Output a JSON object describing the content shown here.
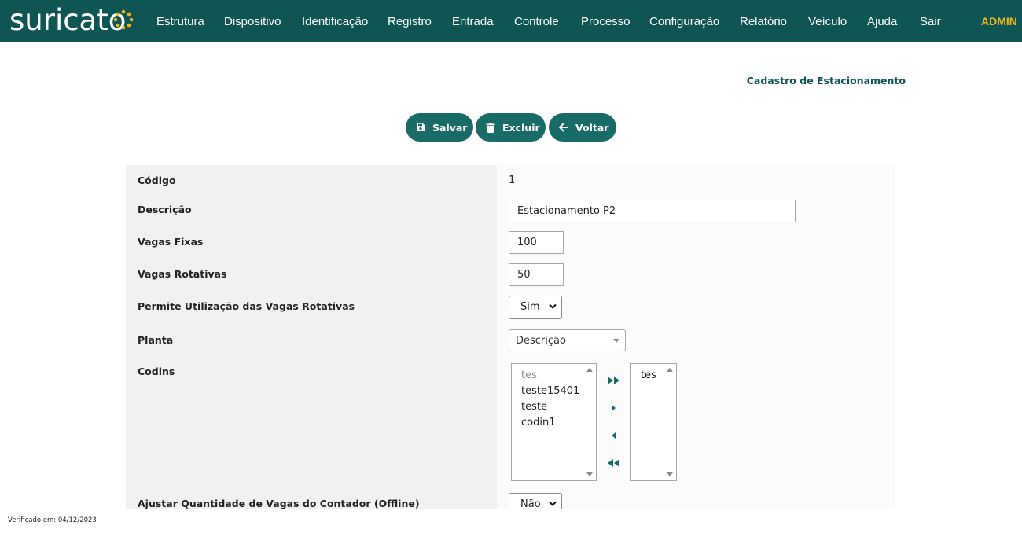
{
  "app": {
    "logo_text": "suricato"
  },
  "nav": {
    "items": [
      "Estrutura",
      "Dispositivo",
      "Identificação",
      "Registro",
      "Entrada",
      "Controle",
      "Processo",
      "Configuração",
      "Relatório",
      "Veículo",
      "Ajuda",
      "Sair"
    ],
    "user": "ADMIN"
  },
  "page": {
    "title": "Cadastro de Estacionamento"
  },
  "toolbar": {
    "save_label": "Salvar",
    "delete_label": "Excluir",
    "back_label": "Voltar"
  },
  "form": {
    "codigo": {
      "label": "Código",
      "value": "1"
    },
    "descricao": {
      "label": "Descrição",
      "value": "Estacionamento P2"
    },
    "vagas_fixas": {
      "label": "Vagas Fixas",
      "value": "100"
    },
    "vagas_rotativas": {
      "label": "Vagas Rotativas",
      "value": "50"
    },
    "permite_rotativas": {
      "label": "Permite Utilização das Vagas Rotativas",
      "value": "Sim"
    },
    "planta": {
      "label": "Planta",
      "value": "Descrição"
    },
    "codins": {
      "label": "Codins",
      "available": [
        "tes",
        "teste15401",
        "teste",
        "codin1"
      ],
      "selected": [
        "tes"
      ]
    },
    "ajustar_contador": {
      "label": "Ajustar Quantidade de Vagas do Contador (Offline)",
      "value": "Não"
    }
  },
  "footer": {
    "verified": "Verificado em: 04/12/2023"
  },
  "colors": {
    "nav_bg": "#0f5554",
    "accent": "#186b66",
    "admin": "#f5b31b",
    "logo_dots": "#f5b31b"
  }
}
